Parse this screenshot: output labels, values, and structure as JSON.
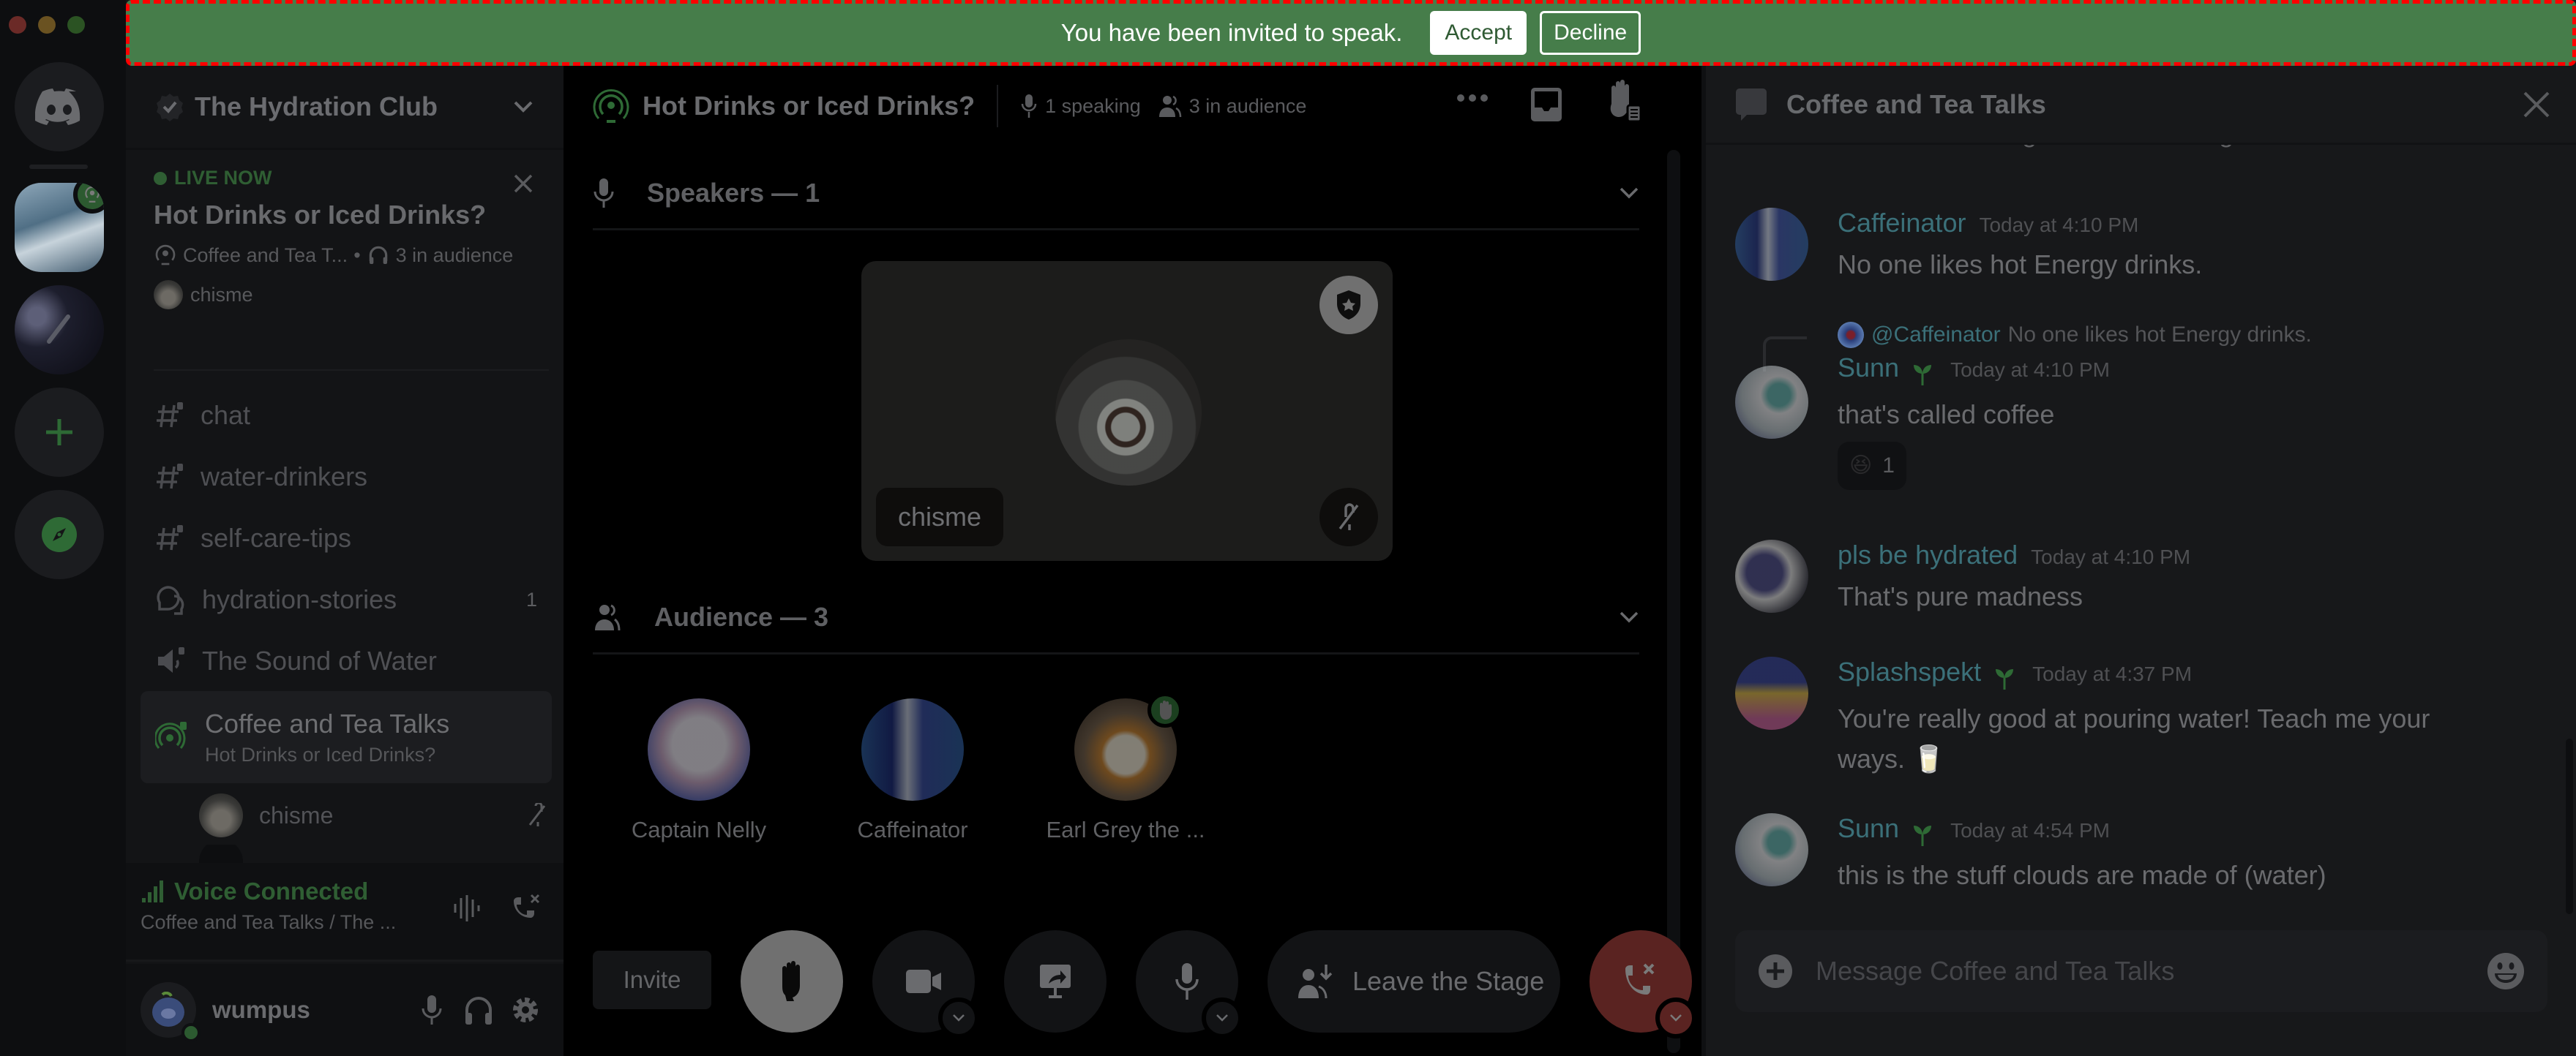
{
  "window": {
    "controls": [
      "close",
      "minimize",
      "maximize"
    ]
  },
  "banner": {
    "message": "You have been invited to speak.",
    "accept_label": "Accept",
    "decline_label": "Decline",
    "bg_color": "#467d4a"
  },
  "server_rail": {
    "items": [
      {
        "name": "Direct Messages",
        "icon": "discord-logo-icon"
      },
      {
        "name": "The Hydration Club",
        "icon": "water-glass-server-icon",
        "live_stage": true
      },
      {
        "name": "Microphone server",
        "icon": "microphone-server-icon"
      },
      {
        "name": "Add a Server",
        "icon": "plus-icon"
      },
      {
        "name": "Explore Discoverable Servers",
        "icon": "compass-icon"
      }
    ]
  },
  "sidebar": {
    "server_name": "The Hydration Club",
    "live_card": {
      "status": "LIVE NOW",
      "title": "Hot Drinks or Iced Drinks?",
      "channel": "Coffee and Tea T...",
      "separator": "•",
      "audience": "3 in audience",
      "host": "chisme"
    },
    "channels": [
      {
        "name": "chat",
        "type": "text-locked"
      },
      {
        "name": "water-drinkers",
        "type": "text-locked"
      },
      {
        "name": "self-care-tips",
        "type": "text-locked"
      },
      {
        "name": "hydration-stories",
        "type": "forum",
        "badge": "1"
      },
      {
        "name": "The Sound of Water",
        "type": "voice-locked"
      },
      {
        "name": "Coffee and Tea Talks",
        "type": "stage-locked",
        "subtitle": "Hot Drinks or Iced Drinks?",
        "active": true
      }
    ],
    "voice_users": [
      {
        "name": "chisme",
        "muted": true
      }
    ],
    "voice_panel": {
      "status": "Voice Connected",
      "location": "Coffee and Tea Talks / The ..."
    },
    "user": {
      "name": "wumpus",
      "status": "online"
    }
  },
  "stage": {
    "header": {
      "title": "Hot Drinks or Iced Drinks?",
      "speaking": "1 speaking",
      "audience": "3 in audience"
    },
    "speakers_label": "Speakers — 1",
    "speakers": [
      {
        "name": "chisme",
        "moderator": true,
        "muted": true
      }
    ],
    "audience_label": "Audience — 3",
    "audience": [
      {
        "name": "Captain Nelly",
        "hand_raised": false
      },
      {
        "name": "Caffeinator",
        "hand_raised": false
      },
      {
        "name": "Earl Grey the ...",
        "hand_raised": true
      }
    ],
    "controls": {
      "invite_label": "Invite",
      "leave_label": "Leave the Stage",
      "end_call_color": "#5a2321"
    }
  },
  "chat": {
    "title": "Coffee and Tea Talks",
    "partial_top_text": "toss it in the fridge and it's cold again.",
    "messages": [
      {
        "author": "Caffeinator",
        "time": "Today at 4:10 PM",
        "text": "No one likes hot Energy drinks."
      },
      {
        "author": "Sunn",
        "badge": "sprout",
        "time": "Today at 4:10 PM",
        "text": "that's called coffee",
        "reply_to": {
          "author": "@Caffeinator",
          "text": "No one likes hot Energy drinks."
        },
        "reaction": {
          "emoji": "😆",
          "count": "1"
        }
      },
      {
        "author": "pls be hydrated",
        "time": "Today at 4:10 PM",
        "text": "That's pure madness"
      },
      {
        "author": "Splashspekt",
        "badge": "sprout",
        "time": "Today at 4:37 PM",
        "text": "You're really good at pouring water! Teach me your ways. 🥛"
      },
      {
        "author": "Sunn",
        "badge": "sprout",
        "time": "Today at 4:54 PM",
        "text": "this is the stuff clouds are made of (water)"
      }
    ],
    "input_placeholder": "Message Coffee and Tea Talks"
  },
  "colors": {
    "accent_green": "#2f5e33",
    "username_teal": "#3b7079",
    "banner_border": "#ff0000"
  }
}
